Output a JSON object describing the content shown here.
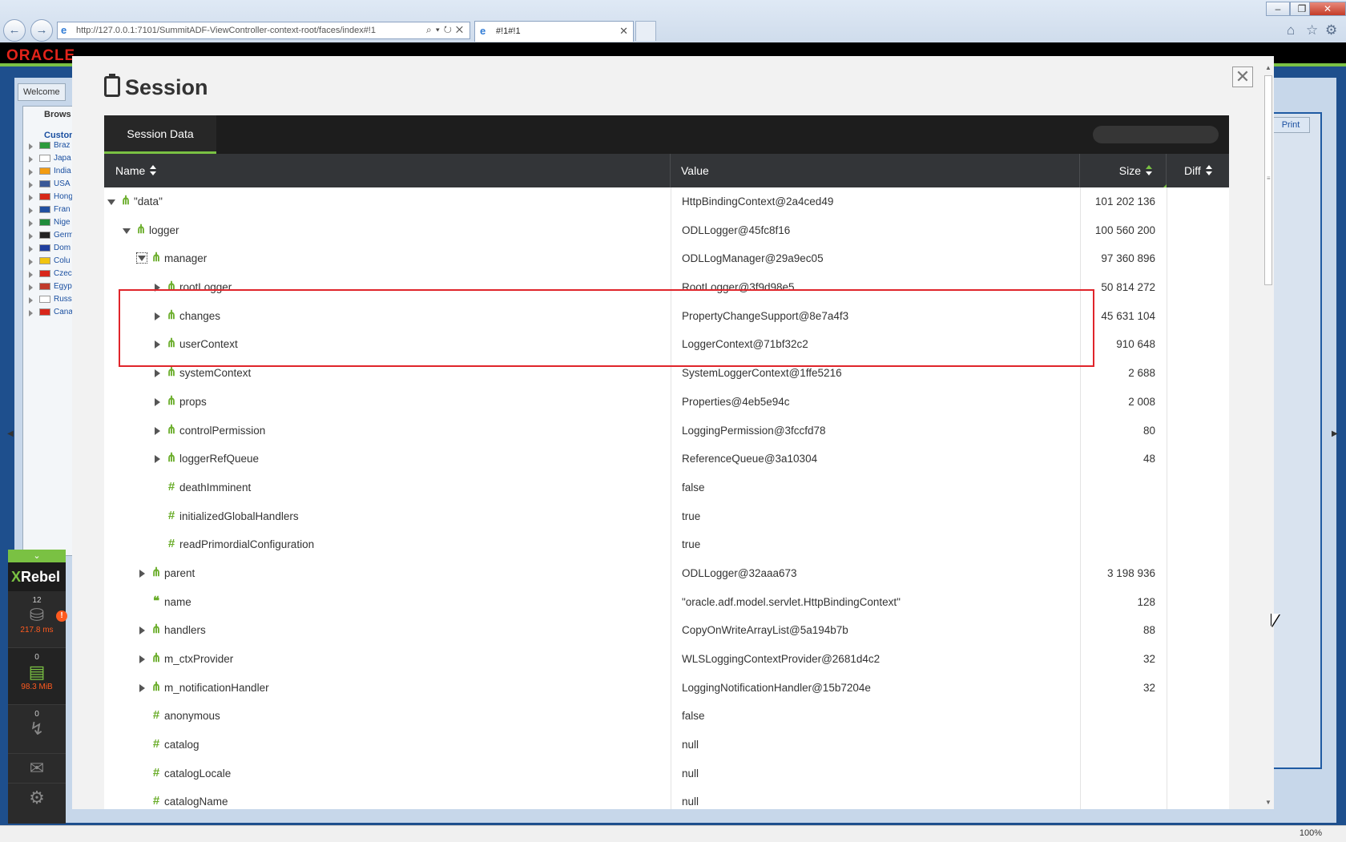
{
  "browser": {
    "url": "http://127.0.0.1:7101/SummitADF-ViewController-context-root/faces/index#!1",
    "tab_title": "#!1#!1",
    "zoom": "100%"
  },
  "app": {
    "logo": "ORACLE",
    "welcome_tab": "Welcome",
    "browse_label": "Brows",
    "customers_label": "Custom",
    "countries": [
      "Braz",
      "Japa",
      "India",
      "USA",
      "Hong",
      "Fran",
      "Nige",
      "Germ",
      "Dom",
      "Colu",
      "Czec",
      "Egyp",
      "Russ",
      "Cana"
    ],
    "print_label": "Print"
  },
  "xrebel": {
    "brand_x": "X",
    "brand_rest": "Rebel",
    "db_count": "12",
    "db_time": "217.8 ms",
    "session_count": "0",
    "session_size": "98.3 MiB",
    "exceptions_count": "0",
    "icons": [
      "chevron-down-icon",
      "database-icon",
      "document-icon",
      "lightning-icon",
      "mail-icon",
      "gear-icon"
    ]
  },
  "modal": {
    "title": "Session",
    "close_glyph": "✕",
    "tab_label": "Session Data",
    "search_placeholder": "",
    "columns": {
      "name": "Name",
      "value": "Value",
      "size": "Size",
      "diff": "Diff"
    },
    "highlight_color": "#e0252b",
    "accent_color": "#7ac143",
    "rows": [
      {
        "level": 0,
        "toggle": "open",
        "icon": "object",
        "name": "\"data\"",
        "value": "HttpBindingContext@2a4ced49",
        "size": "101 202 136"
      },
      {
        "level": 1,
        "toggle": "open",
        "icon": "object",
        "name": "logger",
        "value": "ODLLogger@45fc8f16",
        "size": "100 560 200"
      },
      {
        "level": 2,
        "toggle": "open-focus",
        "icon": "object",
        "name": "manager",
        "value": "ODLLogManager@29a9ec05",
        "size": "97 360 896"
      },
      {
        "level": 3,
        "toggle": "closed",
        "icon": "object",
        "name": "rootLogger",
        "value": "RootLogger@3f9d98e5",
        "size": "50 814 272"
      },
      {
        "level": 3,
        "toggle": "closed",
        "icon": "object",
        "name": "changes",
        "value": "PropertyChangeSupport@8e7a4f3",
        "size": "45 631 104"
      },
      {
        "level": 3,
        "toggle": "closed",
        "icon": "object",
        "name": "userContext",
        "value": "LoggerContext@71bf32c2",
        "size": "910 648"
      },
      {
        "level": 3,
        "toggle": "closed",
        "icon": "object",
        "name": "systemContext",
        "value": "SystemLoggerContext@1ffe5216",
        "size": "2 688"
      },
      {
        "level": 3,
        "toggle": "closed",
        "icon": "object",
        "name": "props",
        "value": "Properties@4eb5e94c",
        "size": "2 008"
      },
      {
        "level": 3,
        "toggle": "closed",
        "icon": "object",
        "name": "controlPermission",
        "value": "LoggingPermission@3fccfd78",
        "size": "80"
      },
      {
        "level": 3,
        "toggle": "closed",
        "icon": "object",
        "name": "loggerRefQueue",
        "value": "ReferenceQueue@3a10304",
        "size": "48"
      },
      {
        "level": 3,
        "toggle": "none",
        "icon": "primitive",
        "name": "deathImminent",
        "value": "false",
        "size": ""
      },
      {
        "level": 3,
        "toggle": "none",
        "icon": "primitive",
        "name": "initializedGlobalHandlers",
        "value": "true",
        "size": ""
      },
      {
        "level": 3,
        "toggle": "none",
        "icon": "primitive",
        "name": "readPrimordialConfiguration",
        "value": "true",
        "size": ""
      },
      {
        "level": 2,
        "toggle": "closed",
        "icon": "object",
        "name": "parent",
        "value": "ODLLogger@32aaa673",
        "size": "3 198 936"
      },
      {
        "level": 2,
        "toggle": "none",
        "icon": "string",
        "name": "name",
        "value": "\"oracle.adf.model.servlet.HttpBindingContext\"",
        "size": "128"
      },
      {
        "level": 2,
        "toggle": "closed",
        "icon": "object",
        "name": "handlers",
        "value": "CopyOnWriteArrayList@5a194b7b",
        "size": "88"
      },
      {
        "level": 2,
        "toggle": "closed",
        "icon": "object",
        "name": "m_ctxProvider",
        "value": "WLSLoggingContextProvider@2681d4c2",
        "size": "32"
      },
      {
        "level": 2,
        "toggle": "closed",
        "icon": "object",
        "name": "m_notificationHandler",
        "value": "LoggingNotificationHandler@15b7204e",
        "size": "32"
      },
      {
        "level": 2,
        "toggle": "none",
        "icon": "primitive",
        "name": "anonymous",
        "value": "false",
        "size": ""
      },
      {
        "level": 2,
        "toggle": "none",
        "icon": "primitive",
        "name": "catalog",
        "value": "null",
        "size": ""
      },
      {
        "level": 2,
        "toggle": "none",
        "icon": "primitive",
        "name": "catalogLocale",
        "value": "null",
        "size": ""
      },
      {
        "level": 2,
        "toggle": "none",
        "icon": "primitive",
        "name": "catalogName",
        "value": "null",
        "size": ""
      }
    ]
  }
}
